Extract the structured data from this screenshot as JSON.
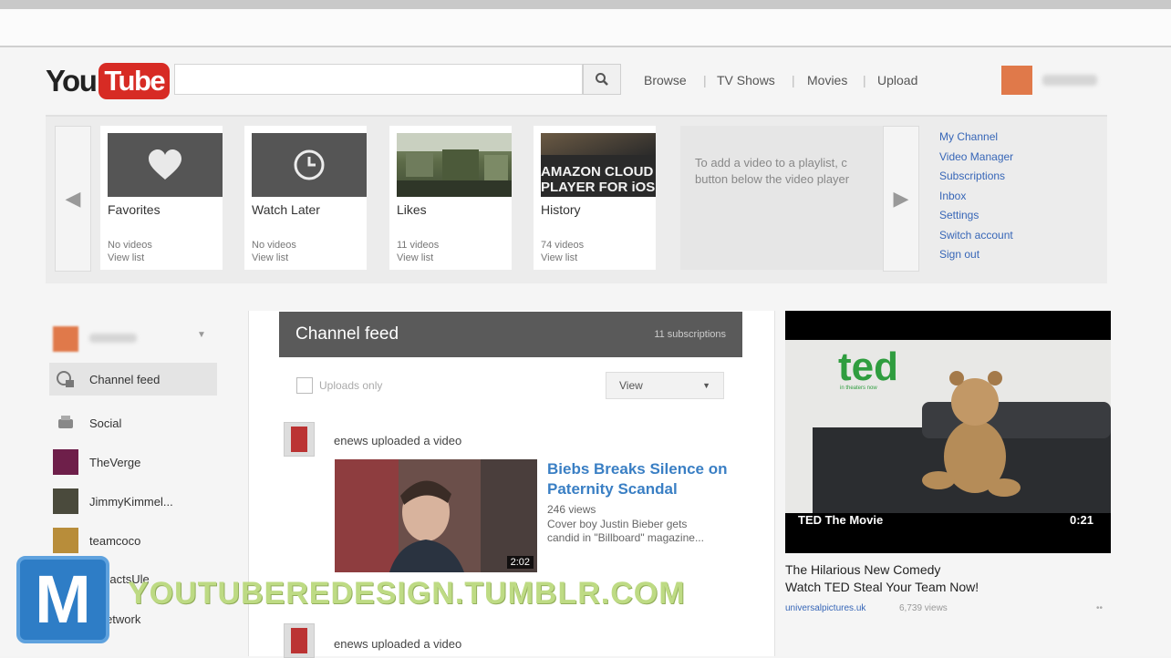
{
  "logo": {
    "you": "You",
    "tube": "Tube"
  },
  "search": {
    "placeholder": ""
  },
  "nav": [
    "Browse",
    "TV Shows",
    "Movies",
    "Upload"
  ],
  "guide": {
    "tiles": [
      {
        "name": "Favorites",
        "count": "No videos",
        "link": "View list"
      },
      {
        "name": "Watch Later",
        "count": "No videos",
        "link": "View list"
      },
      {
        "name": "Likes",
        "count": "11 videos",
        "link": "View list"
      },
      {
        "name": "History",
        "count": "74 videos",
        "link": "View list"
      }
    ],
    "history_thumb_text": [
      "AMAZON CLOUD",
      "PLAYER FOR iOS"
    ],
    "hint_lines": [
      "To add a video to a playlist, c",
      "button below the video player"
    ],
    "user_menu": [
      "My Channel",
      "Video Manager",
      "Subscriptions",
      "Inbox",
      "Settings",
      "Switch account",
      "Sign out"
    ]
  },
  "sidebar": {
    "items": [
      {
        "label": "Channel feed",
        "icon": "channel-feed-icon"
      },
      {
        "label": "Social",
        "icon": "social-icon"
      },
      {
        "label": "TheVerge",
        "icon": "channel-avatar"
      },
      {
        "label": "JimmyKimmel...",
        "icon": "channel-avatar"
      },
      {
        "label": "teamcoco",
        "icon": "channel-avatar"
      },
      {
        "label": "...IFactsUle",
        "icon": "channel-avatar"
      },
      {
        "label": "...network",
        "icon": "channel-avatar"
      }
    ]
  },
  "feed": {
    "title": "Channel feed",
    "count": "11 subscriptions",
    "uploads_only": "Uploads only",
    "view_label": "View",
    "items": [
      {
        "channel": "enews",
        "action": "uploaded a video",
        "video_title": "Biebs Breaks Silence on Paternity Scandal",
        "views": "246 views",
        "desc_lines": [
          "Cover boy Justin Bieber gets",
          "candid in \"Billboard\" magazine..."
        ],
        "duration": "2:02"
      },
      {
        "channel": "enews",
        "action": "uploaded a video"
      }
    ]
  },
  "ad": {
    "logo_text": "ted",
    "logo_sub": "in theaters now",
    "caption": "TED The Movie",
    "duration": "0:21",
    "title_lines": [
      "The Hilarious New Comedy",
      "Watch TED Steal Your Team Now!"
    ],
    "source": "universalpictures.uk",
    "views": "6,739 views"
  },
  "watermark": {
    "badge": "M",
    "text": "YOUTUBEREDESIGN.TUMBLR.COM"
  },
  "colors": {
    "youtube_red": "#d72b24",
    "link_blue": "#3766b7",
    "title_blue": "#3a7fc4",
    "ted_green": "#2f9d3f"
  }
}
